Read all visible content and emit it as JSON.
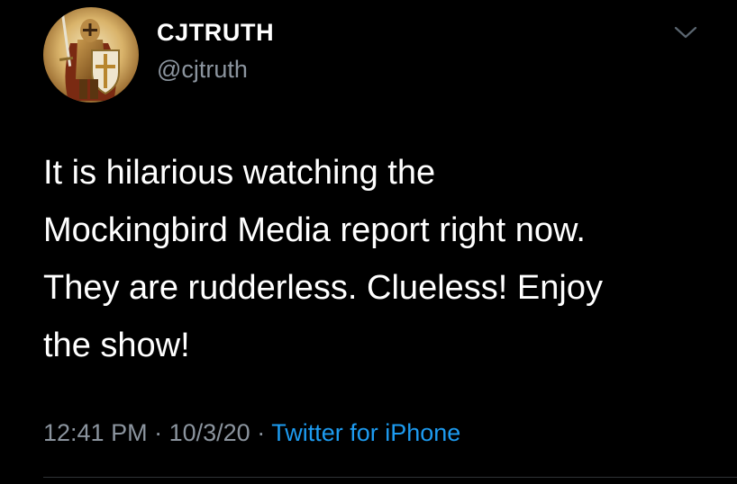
{
  "tweet": {
    "author": {
      "display_name": "CJTRUTH",
      "handle": "@cjtruth",
      "avatar_icon": "knight-crusader-avatar"
    },
    "menu_icon": "chevron-down-icon",
    "text_lines": [
      "It is hilarious watching the",
      "Mockingbird Media report right now.",
      "They are rudderless. Clueless! Enjoy",
      "the show!"
    ],
    "time": "12:41 PM",
    "separator": "·",
    "date": "10/3/20",
    "source": "Twitter for iPhone"
  },
  "colors": {
    "background": "#000000",
    "primary_text": "#ffffff",
    "secondary_text": "#8b949e",
    "link": "#1d9bf0",
    "divider": "#2f3336"
  }
}
